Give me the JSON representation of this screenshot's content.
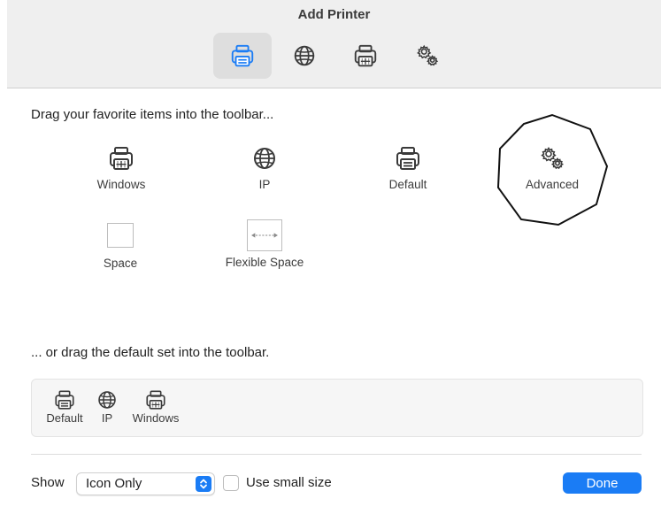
{
  "window": {
    "title": "Add Printer"
  },
  "toolbar": {
    "buttons": [
      {
        "name": "default",
        "selected": true
      },
      {
        "name": "ip",
        "selected": false
      },
      {
        "name": "windows",
        "selected": false
      },
      {
        "name": "advanced",
        "selected": false
      }
    ]
  },
  "palette": {
    "heading": "Drag your favorite items into the toolbar...",
    "items": {
      "windows": "Windows",
      "ip": "IP",
      "default": "Default",
      "advanced": "Advanced",
      "space": "Space",
      "flexible_space": "Flexible Space"
    }
  },
  "default_set": {
    "heading": "... or drag the default set into the toolbar.",
    "items": [
      "Default",
      "IP",
      "Windows"
    ]
  },
  "footer": {
    "show_label": "Show",
    "show_value": "Icon Only",
    "small_size_label": "Use small size",
    "small_size_checked": false,
    "done_label": "Done"
  },
  "colors": {
    "accent": "#1a7cf5",
    "titlebar": "#efefef",
    "selected_button": "#dedede"
  },
  "icons": {
    "default": "printer-icon",
    "ip": "globe-icon",
    "windows": "windows-printer-icon",
    "advanced": "gears-icon"
  }
}
